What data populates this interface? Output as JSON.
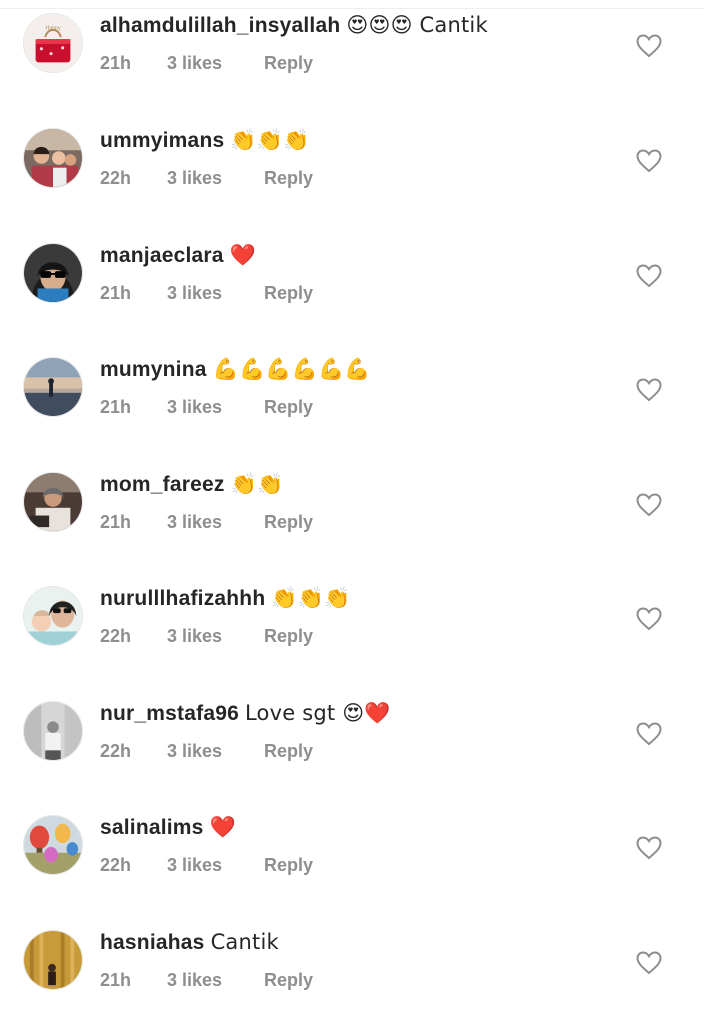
{
  "comments": [
    {
      "username": "alhamdulillah_insyallah",
      "text": "😍😍😍 Cantik",
      "time": "21h",
      "likes": "3 likes",
      "reply": "Reply",
      "avatar": "red-cake"
    },
    {
      "username": "ummyimans",
      "text": "👏👏👏",
      "time": "22h",
      "likes": "3 likes",
      "reply": "Reply",
      "avatar": "family-selfie"
    },
    {
      "username": "manjaeclara",
      "text": "❤️",
      "time": "21h",
      "likes": "3 likes",
      "reply": "Reply",
      "avatar": "sunglasses-hijab"
    },
    {
      "username": "mumynina",
      "text": "💪💪💪💪💪💪",
      "time": "21h",
      "likes": "3 likes",
      "reply": "Reply",
      "avatar": "beach-sunset"
    },
    {
      "username": "mom_fareez",
      "text": "👏👏",
      "time": "21h",
      "likes": "3 likes",
      "reply": "Reply",
      "avatar": "indoor-photo"
    },
    {
      "username": "nurulllhafizahhh",
      "text": "👏👏👏",
      "time": "22h",
      "likes": "3 likes",
      "reply": "Reply",
      "avatar": "mother-baby"
    },
    {
      "username": "nur_mstafa96",
      "text": "Love sgt 😍❤️",
      "time": "22h",
      "likes": "3 likes",
      "reply": "Reply",
      "avatar": "bw-photo"
    },
    {
      "username": "salinalims",
      "text": "❤️",
      "time": "22h",
      "likes": "3 likes",
      "reply": "Reply",
      "avatar": "hot-air-balloons"
    },
    {
      "username": "hasniahas",
      "text": "Cantik",
      "time": "21h",
      "likes": "3 likes",
      "reply": "Reply",
      "avatar": "golden-curtain"
    }
  ],
  "colors": {
    "text": "#262626",
    "meta": "#8e8e8e",
    "heart_outline": "#8e8e8e",
    "background": "#ffffff"
  },
  "icons": {
    "like": "heart-outline-icon"
  }
}
